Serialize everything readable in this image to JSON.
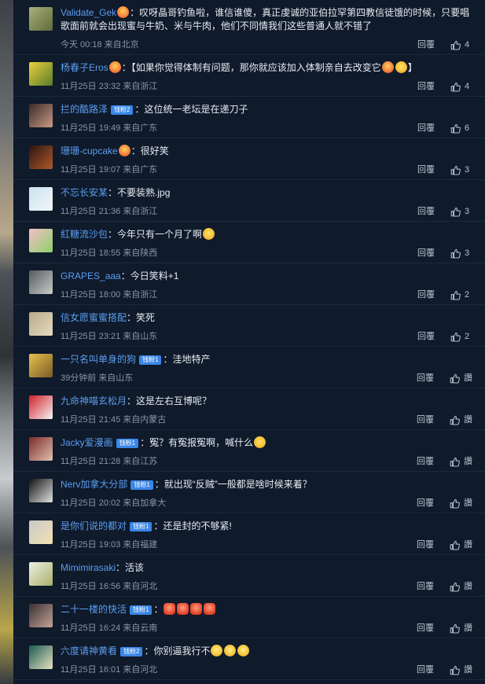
{
  "comments": [
    {
      "user": "Validate_Gek",
      "badge": "",
      "text": "：叹呀晶哥钓鱼啦，谁信谁傻，真正虔诚的亚伯拉罕第四教信徒饿的时候，只要唱歌面前就会出现蜜与牛奶、米与牛肉，他们不同情我们这些普通人就不错了",
      "time": "今天 00:18 来自北京",
      "likes": "4",
      "avatar": [
        "#a9b07a",
        "#5e6b3a"
      ]
    },
    {
      "user": "杨春子Eros",
      "badge": "",
      "text": "：【如果你觉得体制有问题，那你就应该加入体制亲自去改变它",
      "tail": "】",
      "time": "11月25日 23:32 来自浙江",
      "likes": "4",
      "avatar": [
        "#e8d23e",
        "#5a7a2a"
      ]
    },
    {
      "user": "拦的酷路泽",
      "badge": "钱粉2",
      "text": "：这位统一老坛是在递刀子",
      "time": "11月25日 19:49 来自广东",
      "likes": "6",
      "avatar": [
        "#3b2a26",
        "#c89a86"
      ]
    },
    {
      "user": "珊珊-cupcake",
      "badge": "",
      "text": "：很好笑",
      "time": "11月25日 19:07 来自广东",
      "likes": "3",
      "avatar": [
        "#2a1412",
        "#b05a2a"
      ]
    },
    {
      "user": "不忘长安某",
      "badge": "",
      "text": "：不要装熟.jpg",
      "time": "11月25日 21:36 来自浙江",
      "likes": "3",
      "avatar": [
        "#c8e2f0",
        "#f4f6f8"
      ]
    },
    {
      "user": "紅糖流沙包",
      "badge": "",
      "text": "：今年只有一个月了啊",
      "time": "11月25日 18:55 来自陕西",
      "likes": "3",
      "avatar": [
        "#f4c0c6",
        "#8bd06a"
      ]
    },
    {
      "user": "GRAPES_aaa",
      "badge": "",
      "text": "：今日笑料+1",
      "time": "11月25日 18:00 来自浙江",
      "likes": "2",
      "avatar": [
        "#555a5e",
        "#c9cbc8"
      ]
    },
    {
      "user": "信女愿蜜蜜搭配",
      "badge": "",
      "text": "：笑死",
      "time": "11月25日 23:21 来自山东",
      "likes": "2",
      "avatar": [
        "#b8a98a",
        "#e6dcc2"
      ]
    },
    {
      "user": "一只名叫单身的狗",
      "badge": "钱粉1",
      "text": "：洼地特产",
      "time": "39分钟前 来自山东",
      "likes": "讚",
      "avatar": [
        "#e8c24a",
        "#7a5a2a"
      ]
    },
    {
      "user": "九命神喵玄松月",
      "badge": "",
      "text": "：这是左右互博呢？",
      "time": "11月25日 21:45 来自内蒙古",
      "likes": "讚",
      "avatar": [
        "#d2202a",
        "#f4f4f4"
      ]
    },
    {
      "user": "Jacky爱漫画",
      "badge": "钱粉1",
      "text": "：冤？有冤报冤啊，喊什么",
      "time": "11月25日 21:28 来自江苏",
      "likes": "讚",
      "avatar": [
        "#7a2a2a",
        "#e4c0b0"
      ]
    },
    {
      "user": "Nerv加拿大分部",
      "badge": "钱粉1",
      "text": "：就出现“反贼”一般都是啥时候来着？",
      "time": "11月25日 20:02 来自加拿大",
      "likes": "讚",
      "avatar": [
        "#111111",
        "#e0e0e0"
      ]
    },
    {
      "user": "是你们说的都对",
      "badge": "钱粉1",
      "text": "：还是封的不够紧!",
      "time": "11月25日 19:03 来自福建",
      "likes": "讚",
      "avatar": [
        "#c8c8c8",
        "#f2e2b2"
      ]
    },
    {
      "user": "Mimimirasaki",
      "badge": "",
      "text": "：活该",
      "time": "11月25日 16:56 来自河北",
      "likes": "讚",
      "avatar": [
        "#eef0e4",
        "#a8b06a"
      ]
    },
    {
      "user": "二十一楼的快活",
      "badge": "钱粉1",
      "text": "：",
      "time": "11月25日 16:24 来自云南",
      "likes": "讚",
      "avatar": [
        "#3a3030",
        "#c4a49a"
      ]
    },
    {
      "user": "六度请神黄看",
      "badge": "钱粉2",
      "text": "：你别逼我行不",
      "time": "11月25日 16:01 来自河北",
      "likes": "讚",
      "avatar": [
        "#1b5a52",
        "#e8e2c0"
      ]
    }
  ],
  "labels": {
    "reply": "回覆"
  },
  "icons": {
    "like": "thumbs-up-icon",
    "emoji": "emoji-icon"
  }
}
